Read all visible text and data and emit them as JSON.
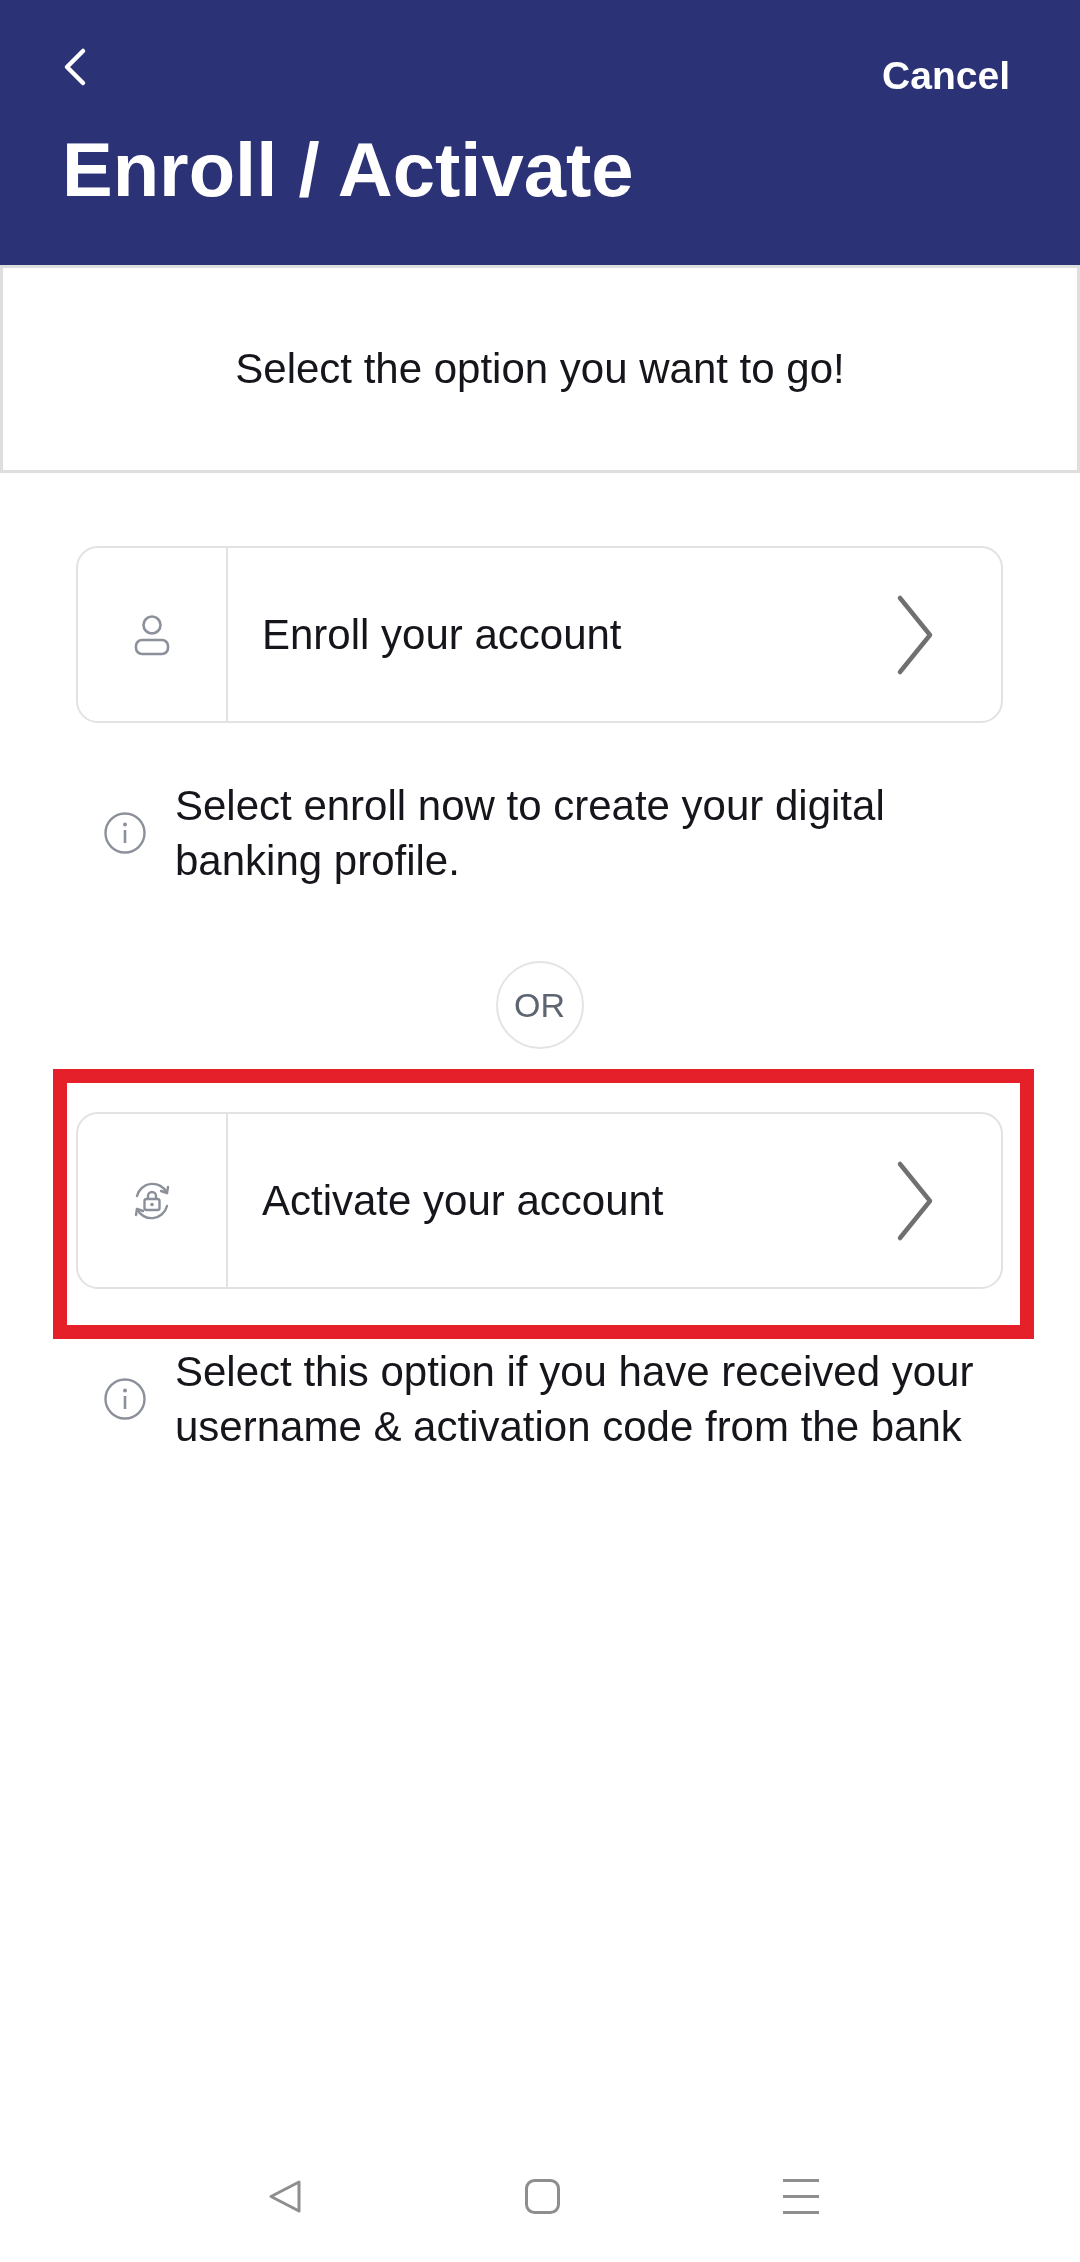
{
  "header": {
    "cancel": "Cancel",
    "title": "Enroll / Activate"
  },
  "prompt": "Select the option you want to go!",
  "separator": "OR",
  "options": [
    {
      "kind": "enroll",
      "label": "Enroll your account",
      "info": "Select enroll now to create your digital banking profile.",
      "highlighted": false
    },
    {
      "kind": "activate",
      "label": "Activate your account",
      "info": "Select this option if you have received your username & activation code from the bank",
      "highlighted": true
    }
  ],
  "nav_bar": [
    {
      "kind": "back"
    },
    {
      "kind": "home"
    },
    {
      "kind": "menu"
    }
  ]
}
